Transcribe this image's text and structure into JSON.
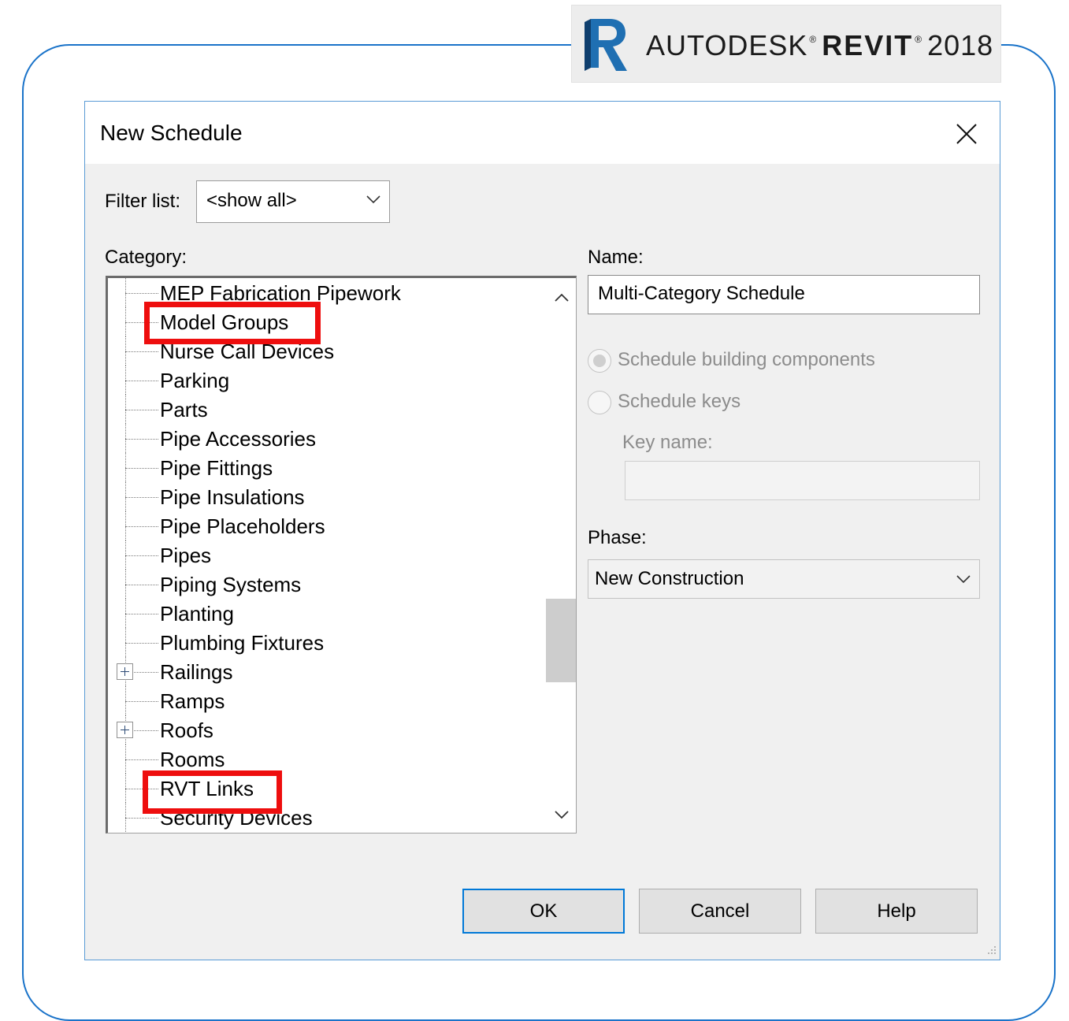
{
  "brand": {
    "name": "AUTODESK",
    "product": "REVIT",
    "version": "2018",
    "trademark": "®"
  },
  "dialog": {
    "title": "New Schedule",
    "filter_label": "Filter list:",
    "filter_value": "<show all>",
    "category_label": "Category:",
    "categories": [
      "MEP Fabrication Pipework",
      "Model Groups",
      "Nurse Call Devices",
      "Parking",
      "Parts",
      "Pipe Accessories",
      "Pipe Fittings",
      "Pipe Insulations",
      "Pipe Placeholders",
      "Pipes",
      "Piping Systems",
      "Planting",
      "Plumbing Fixtures",
      "Railings",
      "Ramps",
      "Roofs",
      "Rooms",
      "RVT Links",
      "Security Devices"
    ],
    "name_label": "Name:",
    "name_value": "Multi-Category Schedule",
    "radio_building": "Schedule building components",
    "radio_keys": "Schedule keys",
    "key_name_label": "Key name:",
    "key_name_value": "",
    "phase_label": "Phase:",
    "phase_value": "New Construction",
    "ok_label": "OK",
    "cancel_label": "Cancel",
    "help_label": "Help"
  },
  "colors": {
    "frame_border": "#1a73c9",
    "highlight": "#ee0e0e",
    "logo_accent": "#1f6fb2",
    "ok_border": "#0078d7"
  },
  "icons": {
    "close": "close-icon",
    "dropdown": "chevron-down-icon",
    "scroll_up": "chevron-up-icon",
    "scroll_down": "chevron-down-icon",
    "expand": "plus-box-icon"
  }
}
